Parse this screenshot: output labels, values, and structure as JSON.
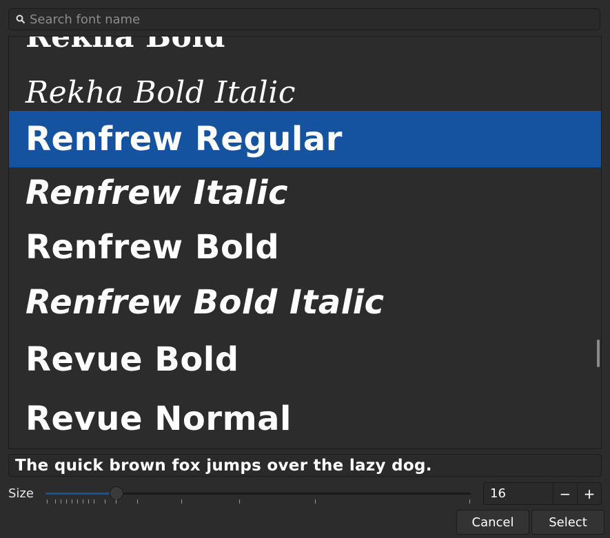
{
  "search": {
    "placeholder": "Search font name",
    "value": ""
  },
  "fonts": [
    {
      "name": "Rekha  Bold",
      "style": "serif-bold"
    },
    {
      "name": "Rekha  Bold  Italic",
      "style": "serif-italic"
    },
    {
      "name": "Renfrew Regular",
      "style": "sans-bold",
      "selected": true
    },
    {
      "name": "Renfrew Italic",
      "style": "sans-bold-italic"
    },
    {
      "name": "Renfrew Bold",
      "style": "sans-bold"
    },
    {
      "name": "Renfrew Bold Italic",
      "style": "sans-bold-italic"
    },
    {
      "name": "Revue Bold",
      "style": "sans-bold"
    },
    {
      "name": "Revue Normal",
      "style": "sans-bold"
    }
  ],
  "preview": {
    "text": "The quick brown fox jumps over the lazy dog."
  },
  "size": {
    "label": "Size",
    "value": "16",
    "decrement_icon": "minus-icon",
    "increment_icon": "plus-icon",
    "decrement_glyph": "−",
    "increment_glyph": "+"
  },
  "slider": {
    "fraction": 0.151
  },
  "actions": {
    "cancel": "Cancel",
    "select": "Select"
  },
  "colors": {
    "accent": "#1553a0",
    "background": "#2c2c2c",
    "text": "#ffffff"
  }
}
